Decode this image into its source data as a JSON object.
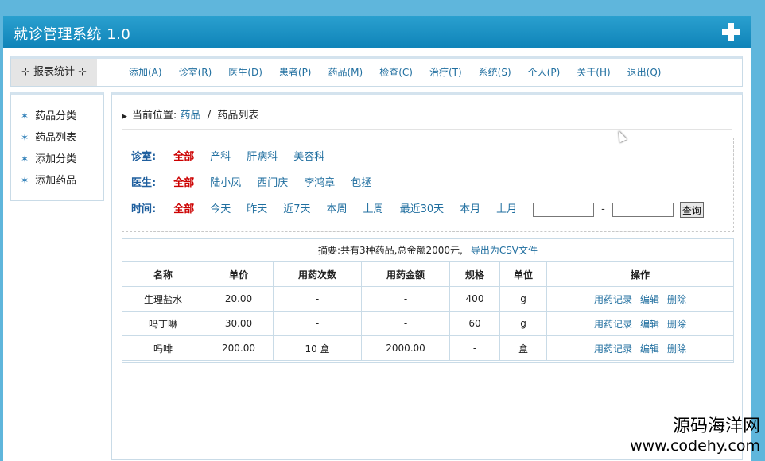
{
  "app": {
    "title": "就诊管理系统 1.0"
  },
  "menubar": {
    "report_label": "报表统计",
    "items": [
      "添加(A)",
      "诊室(R)",
      "医生(D)",
      "患者(P)",
      "药品(M)",
      "检查(C)",
      "治疗(T)",
      "系统(S)",
      "个人(P)",
      "关于(H)",
      "退出(Q)"
    ]
  },
  "sidebar": {
    "items": [
      "药品分类",
      "药品列表",
      "添加分类",
      "添加药品"
    ]
  },
  "breadcrumb": {
    "label": "当前位置:",
    "link": "药品",
    "sep": "/",
    "current": "药品列表"
  },
  "filters": {
    "clinic": {
      "label": "诊室:",
      "options": [
        "全部",
        "产科",
        "肝病科",
        "美容科"
      ],
      "selected": "全部"
    },
    "doctor": {
      "label": "医生:",
      "options": [
        "全部",
        "陆小凤",
        "西门庆",
        "李鸿章",
        "包拯"
      ],
      "selected": "全部"
    },
    "time": {
      "label": "时间:",
      "options": [
        "全部",
        "今天",
        "昨天",
        "近7天",
        "本周",
        "上周",
        "最近30天",
        "本月",
        "上月"
      ],
      "selected": "全部",
      "start_value": "",
      "end_value": "",
      "dash": "-",
      "query_label": "查询"
    }
  },
  "summary": {
    "text": "摘要:共有3种药品,总金额2000元,",
    "export_label": "导出为CSV文件"
  },
  "table": {
    "columns": [
      "名称",
      "单价",
      "用药次数",
      "用药金额",
      "规格",
      "单位",
      "操作"
    ],
    "rows": [
      [
        "生理盐水",
        "20.00",
        "-",
        "-",
        "400",
        "g"
      ],
      [
        "吗丁啉",
        "30.00",
        "-",
        "-",
        "60",
        "g"
      ],
      [
        "吗啡",
        "200.00",
        "10 盒",
        "2000.00",
        "-",
        "盒"
      ]
    ],
    "actions": [
      "用药记录",
      "编辑",
      "删除"
    ]
  },
  "watermark": {
    "line1": "源码海洋网",
    "line2": "www.codehy.com"
  },
  "colors": {
    "titlebar": "#1a92c6",
    "link": "#1f6e9f",
    "selected": "#cc0000",
    "label": "#1f5f9e"
  }
}
